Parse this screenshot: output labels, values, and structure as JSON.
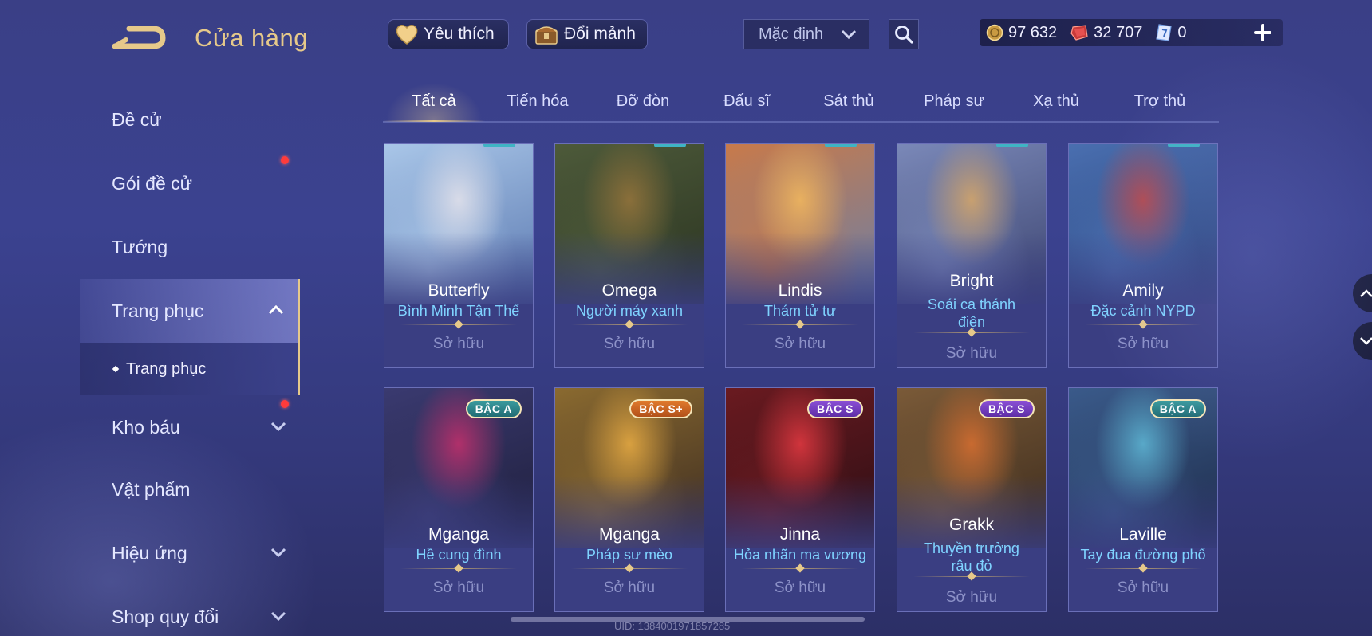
{
  "header": {
    "title": "Cửa hàng",
    "favorites_label": "Yêu thích",
    "exchange_label": "Đổi mảnh",
    "sort_value": "Mặc định"
  },
  "currency": {
    "gold": "97 632",
    "ruby": "32 707",
    "voucher": "0"
  },
  "sidebar": {
    "items": [
      {
        "label": "Đề cử"
      },
      {
        "label": "Gói đề cử"
      },
      {
        "label": "Tướng"
      },
      {
        "label": "Trang phục"
      },
      {
        "label": "Trang phục"
      },
      {
        "label": "Kho báu"
      },
      {
        "label": "Vật phẩm"
      },
      {
        "label": "Hiệu ứng"
      },
      {
        "label": "Shop quy đổi"
      }
    ]
  },
  "tabs": [
    {
      "label": "Tất cả"
    },
    {
      "label": "Tiến hóa"
    },
    {
      "label": "Đỡ đòn"
    },
    {
      "label": "Đấu sĩ"
    },
    {
      "label": "Sát thủ"
    },
    {
      "label": "Pháp sư"
    },
    {
      "label": "Xạ thủ"
    },
    {
      "label": "Trợ thủ"
    }
  ],
  "cards": [
    {
      "hero": "Butterfly",
      "skin": "Bình Minh Tận Thế",
      "status": "Sở hữu",
      "badge": "",
      "art": [
        "#a9c6e8",
        "#5a78b0",
        "#d8dbe8"
      ]
    },
    {
      "hero": "Omega",
      "skin": "Người máy xanh",
      "status": "Sở hữu",
      "badge": "",
      "art": [
        "#4d5a3a",
        "#2a3320",
        "#8a6f3a"
      ]
    },
    {
      "hero": "Lindis",
      "skin": "Thám tử tư",
      "status": "Sở hữu",
      "badge": "",
      "art": [
        "#c87a4a",
        "#6a7fa8",
        "#e8b060"
      ]
    },
    {
      "hero": "Bright",
      "skin": "Soái ca thánh điện",
      "status": "Sở hữu",
      "badge": "",
      "art": [
        "#7a88b8",
        "#3c4470",
        "#c8a070"
      ]
    },
    {
      "hero": "Amily",
      "skin": "Đặc cảnh NYPD",
      "status": "Sở hữu",
      "badge": "",
      "art": [
        "#4a6fb0",
        "#223a70",
        "#b04a50"
      ]
    },
    {
      "hero": "Mganga",
      "skin": "Hề cung đình",
      "status": "Sở hữu",
      "badge": "BẬC A",
      "art": [
        "#3a3a70",
        "#1e1e3a",
        "#b0306a"
      ]
    },
    {
      "hero": "Mganga",
      "skin": "Pháp sư mèo",
      "status": "Sở hữu",
      "badge": "BẬC S+",
      "art": [
        "#8a6a30",
        "#3a2a20",
        "#d8a040"
      ]
    },
    {
      "hero": "Jinna",
      "skin": "Hỏa nhãn ma vương",
      "status": "Sở hữu",
      "badge": "BẬC S",
      "art": [
        "#6a1a20",
        "#2a0e14",
        "#d0343c"
      ]
    },
    {
      "hero": "Grakk",
      "skin": "Thuyền trưởng râu đỏ",
      "status": "Sở hữu",
      "badge": "BẬC S",
      "art": [
        "#7a5a38",
        "#3a2a1c",
        "#c86a30"
      ]
    },
    {
      "hero": "Laville",
      "skin": "Tay đua đường phố",
      "status": "Sở hữu",
      "badge": "BẬC A",
      "art": [
        "#3a5a8a",
        "#1e2c4a",
        "#58a8c8"
      ]
    }
  ],
  "footer": {
    "uid": "UID: 1384001971857285"
  },
  "colors": {
    "accent_gold": "#e6c98a",
    "skin_name": "#7fd3ff",
    "notification": "#ff3b3b"
  }
}
